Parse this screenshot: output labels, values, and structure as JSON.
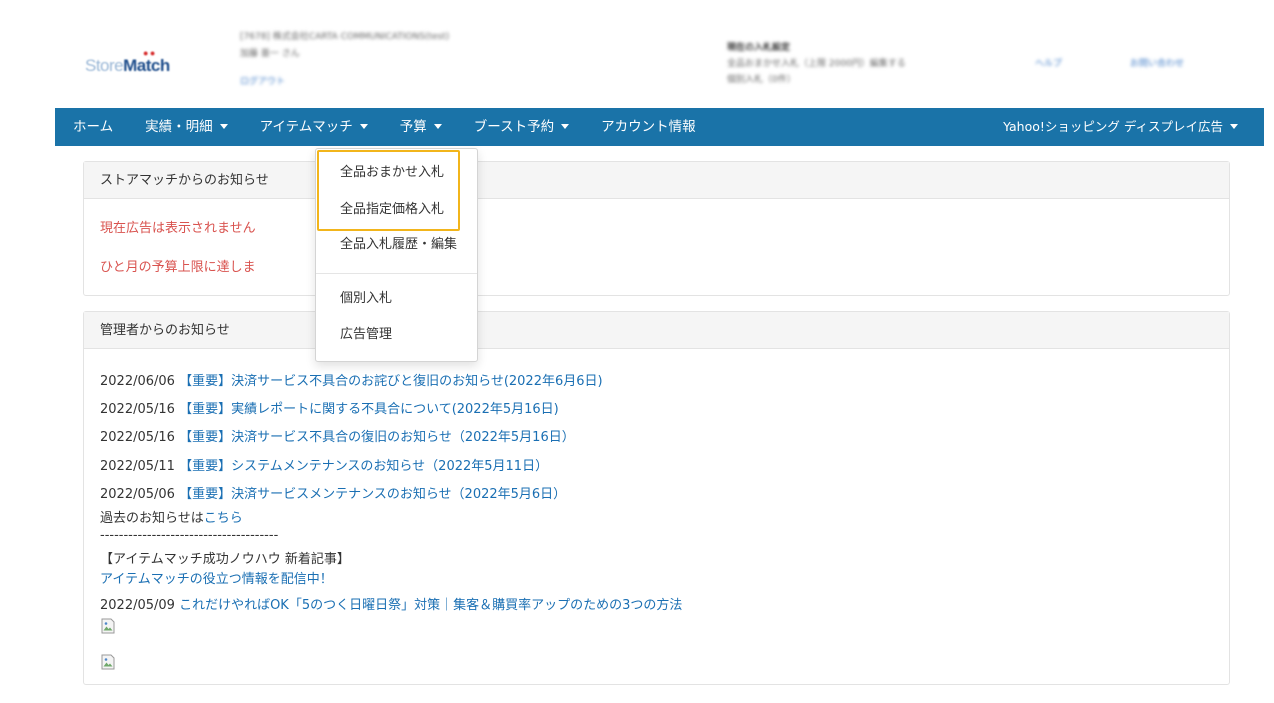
{
  "header": {
    "logo_store": "Store",
    "logo_match": "Match",
    "logo_dots": "● ●",
    "blur_company": "[7678] 株式会社CARTA COMMUNICATIONS(test)",
    "blur_user": "加藤 亜一 さん",
    "blur_logout": "ログアウト",
    "blur_right_title": "現在の入札設定",
    "blur_right_line1": "全品おまかせ入札（上限 2000円）編集する",
    "blur_right_line2": "個別入札（0件）",
    "blur_help": "ヘルプ",
    "blur_contact": "お問い合わせ"
  },
  "navbar": {
    "home": "ホーム",
    "results": "実績・明細",
    "itemmatch": "アイテムマッチ",
    "budget": "予算",
    "boost": "ブースト予約",
    "account": "アカウント情報",
    "right_menu": "Yahoo!ショッピング ディスプレイ広告"
  },
  "dropdown": {
    "items": [
      "全品おまかせ入札",
      "全品指定価格入札",
      "全品入札履歴・編集",
      "個別入札",
      "広告管理"
    ]
  },
  "notice_panel": {
    "heading": "ストアマッチからのお知らせ",
    "line1": "現在広告は表示されません",
    "line2": "ひと月の予算上限に達しま"
  },
  "admin_panel": {
    "heading": "管理者からのお知らせ",
    "news": [
      {
        "date": "2022/06/06",
        "title": "【重要】決済サービス不具合のお詫びと復旧のお知らせ(2022年6月6日)"
      },
      {
        "date": "2022/05/16",
        "title": "【重要】実績レポートに関する不具合について(2022年5月16日)"
      },
      {
        "date": "2022/05/16",
        "title": "【重要】決済サービス不具合の復旧のお知らせ（2022年5月16日）"
      },
      {
        "date": "2022/05/11",
        "title": "【重要】システムメンテナンスのお知らせ（2022年5月11日）"
      },
      {
        "date": "2022/05/06",
        "title": "【重要】決済サービスメンテナンスのお知らせ（2022年5月6日）"
      }
    ],
    "past_prefix": "過去のお知らせは",
    "past_link": "こちら",
    "separator": "--------------------------------------",
    "knowhow_title": "【アイテムマッチ成功ノウハウ 新着記事】",
    "knowhow_link": "アイテムマッチの役立つ情報を配信中！",
    "article_date": "2022/05/09",
    "article_title": "これだけやればOK「5のつく日曜日祭」対策｜集客＆購買率アップのための3つの方法"
  }
}
